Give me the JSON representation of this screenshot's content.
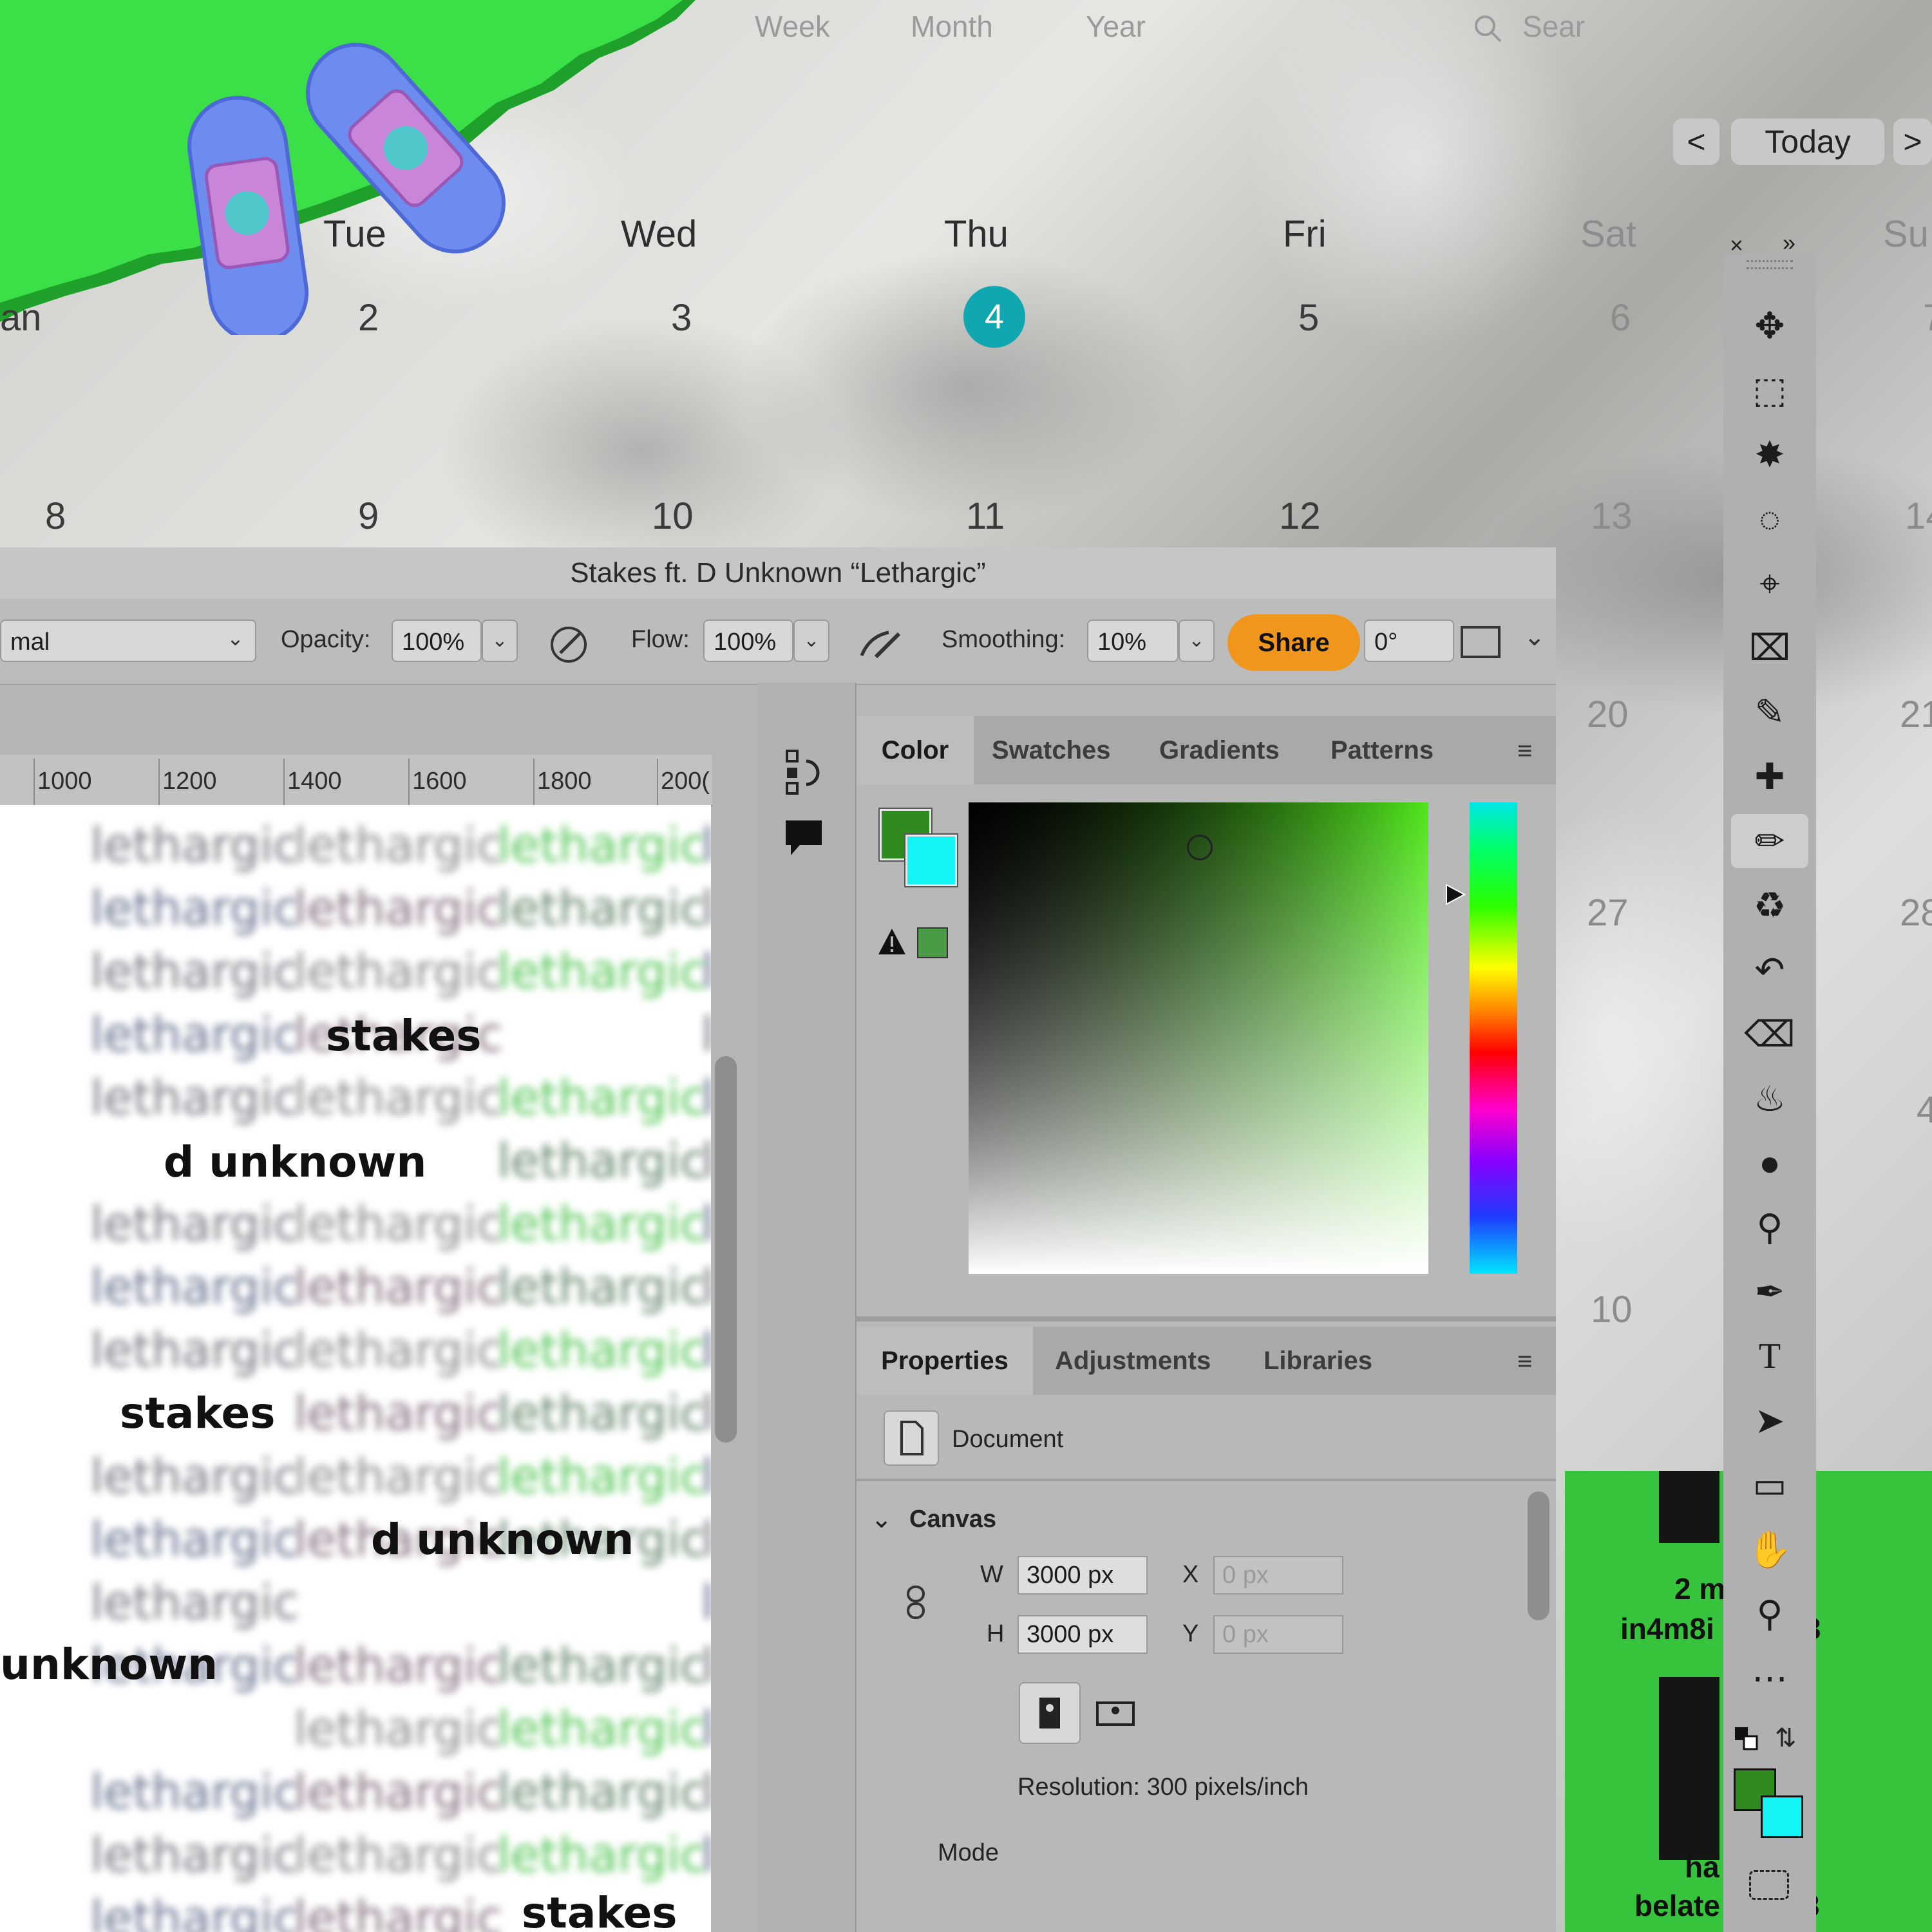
{
  "calendar": {
    "views": [
      "Week",
      "Month",
      "Year"
    ],
    "search_placeholder": "Sear",
    "nav_prev": "<",
    "nav_today": "Today",
    "nav_next": ">",
    "days": [
      "Tue",
      "Wed",
      "Thu",
      "Fri",
      "Sat",
      "Su"
    ],
    "row1": [
      "an",
      "2",
      "3",
      "4",
      "5",
      "6",
      "7"
    ],
    "row2": [
      "8",
      "9",
      "10",
      "11",
      "12",
      "13",
      "14"
    ],
    "right_nums": [
      "20",
      "21",
      "27",
      "28",
      "4",
      "10"
    ]
  },
  "photoshop": {
    "title": "Stakes ft. D Unknown “Lethargic”",
    "options": {
      "mode_value": "mal",
      "opacity_label": "Opacity:",
      "opacity_value": "100%",
      "flow_label": "Flow:",
      "flow_value": "100%",
      "smoothing_label": "Smoothing:",
      "smoothing_value": "10%",
      "share_label": "Share",
      "angle_value": "0°"
    },
    "ruler": [
      "1000",
      "1200",
      "1400",
      "1600",
      "1800",
      "200("
    ],
    "canvas_words": {
      "filler": "lethargic",
      "stakes": "stakes",
      "d_unknown": "d unknown",
      "unknown": "unknown"
    },
    "color_panel": {
      "tabs": [
        "Color",
        "Swatches",
        "Gradients",
        "Patterns"
      ],
      "fg_color": "#2f8a1f",
      "bg_color": "#15f5f5"
    },
    "properties_panel": {
      "tabs": [
        "Properties",
        "Adjustments",
        "Libraries"
      ],
      "document_label": "Document",
      "canvas_section": "Canvas",
      "w_label": "W",
      "w_value": "3000 px",
      "h_label": "H",
      "h_value": "3000 px",
      "x_label": "X",
      "x_value": "0 px",
      "y_label": "Y",
      "y_value": "0 px",
      "resolution": "Resolution: 300 pixels/inch",
      "mode_label": "Mode"
    }
  },
  "thumbnails": {
    "t1_line1": "2 m",
    "t1_line2": "in4m8i",
    "t1_suffix": "3",
    "t2_line1": "ha",
    "t2_line2": "belate",
    "t2_suffix": "3"
  },
  "accent_colors": {
    "today": "#11a7b0",
    "share": "#f0961c",
    "green": "#36c43c"
  }
}
